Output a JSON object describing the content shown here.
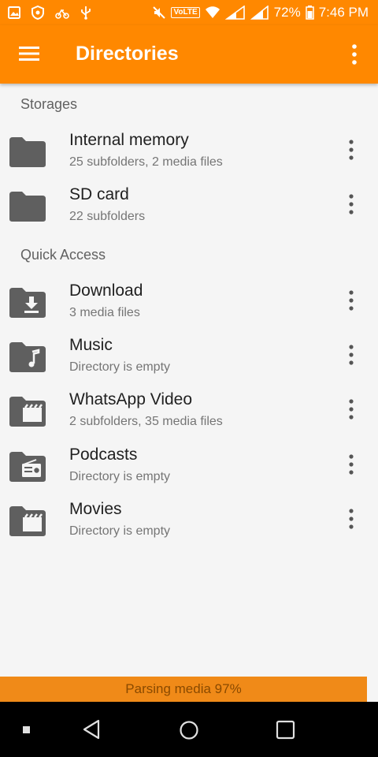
{
  "status_bar": {
    "volte": "VoLTE",
    "battery": "72%",
    "time": "7:46 PM",
    "icons": [
      "image-icon",
      "shield-icon",
      "cycle-icon",
      "usb-icon",
      "mute-icon",
      "wifi-icon",
      "signal-icon",
      "signal-icon",
      "battery-icon"
    ]
  },
  "app_bar": {
    "title": "Directories",
    "menu_icon": "hamburger-menu-icon",
    "overflow_icon": "more-vert-icon"
  },
  "sections": {
    "storages": "Storages",
    "quick_access": "Quick Access"
  },
  "storages": [
    {
      "title": "Internal memory",
      "subtitle": "25 subfolders, 2 media files",
      "icon": "folder-icon"
    },
    {
      "title": "SD card",
      "subtitle": "22 subfolders",
      "icon": "folder-icon"
    }
  ],
  "quick_access": [
    {
      "title": "Download",
      "subtitle": "3 media files",
      "icon": "folder-download-icon"
    },
    {
      "title": "Music",
      "subtitle": "Directory is empty",
      "icon": "folder-music-icon"
    },
    {
      "title": "WhatsApp Video",
      "subtitle": "2 subfolders, 35 media files",
      "icon": "folder-video-icon"
    },
    {
      "title": "Podcasts",
      "subtitle": "Directory is empty",
      "icon": "folder-radio-icon"
    },
    {
      "title": "Movies",
      "subtitle": "Directory is empty",
      "icon": "folder-video-icon"
    }
  ],
  "progress": {
    "label": "Parsing media 97%",
    "value": 0.97
  },
  "nav_bar": {
    "icons": [
      "square-dot-icon",
      "back-icon",
      "home-icon",
      "recents-icon"
    ]
  },
  "colors": {
    "accent": "#ff8800",
    "icon_gray": "#5f5f5f",
    "background": "#f5f5f5"
  }
}
